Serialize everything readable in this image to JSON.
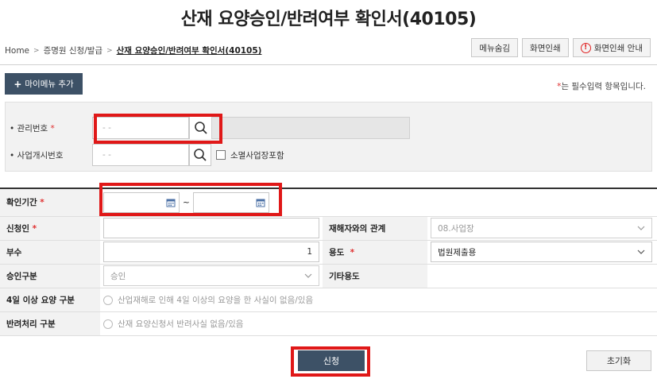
{
  "page_title": "산재 요양승인/반려여부 확인서(40105)",
  "breadcrumb": {
    "home": "Home",
    "level1": "증명원 신청/발급",
    "current": "산재 요양승인/반려여부 확인서(40105)"
  },
  "top_buttons": {
    "menu_hide": "메뉴숨김",
    "print": "화면인쇄",
    "print_guide": "화면인쇄 안내"
  },
  "my_menu_add": "마이메뉴 추가",
  "required_note": {
    "star": "*",
    "text": "는 필수입력 항목입니다."
  },
  "search": {
    "mgmt_no_label": "관리번호",
    "mgmt_no_placeholder": "-   -",
    "biz_no_label": "사업개시번호",
    "biz_no_placeholder": "-   -",
    "include_closed_label": "소멸사업장포함"
  },
  "form": {
    "period_label": "확인기간",
    "period_sep": "~",
    "applicant_label": "신청인",
    "relation_label": "재해자와의 관계",
    "relation_value": "08.사업장",
    "copies_label": "부수",
    "copies_value": "1",
    "purpose_label": "용도",
    "purpose_value": "법원제출용",
    "approval_type_label": "승인구분",
    "approval_type_value": "승인",
    "other_purpose_label": "기타용도",
    "four_day_label": "4일 이상 요양 구분",
    "four_day_option": "산업재해로 인해 4일 이상의 요양을 한 사실이 없음/있음",
    "reject_label": "반려처리 구분",
    "reject_option": "산재 요양신청서 반려사실 없음/있음",
    "required_star": "*"
  },
  "actions": {
    "submit": "신청",
    "reset": "초기화"
  },
  "colors": {
    "primary_button": "#3d5166",
    "highlight_box": "#e01818",
    "required_star": "#e03030"
  }
}
